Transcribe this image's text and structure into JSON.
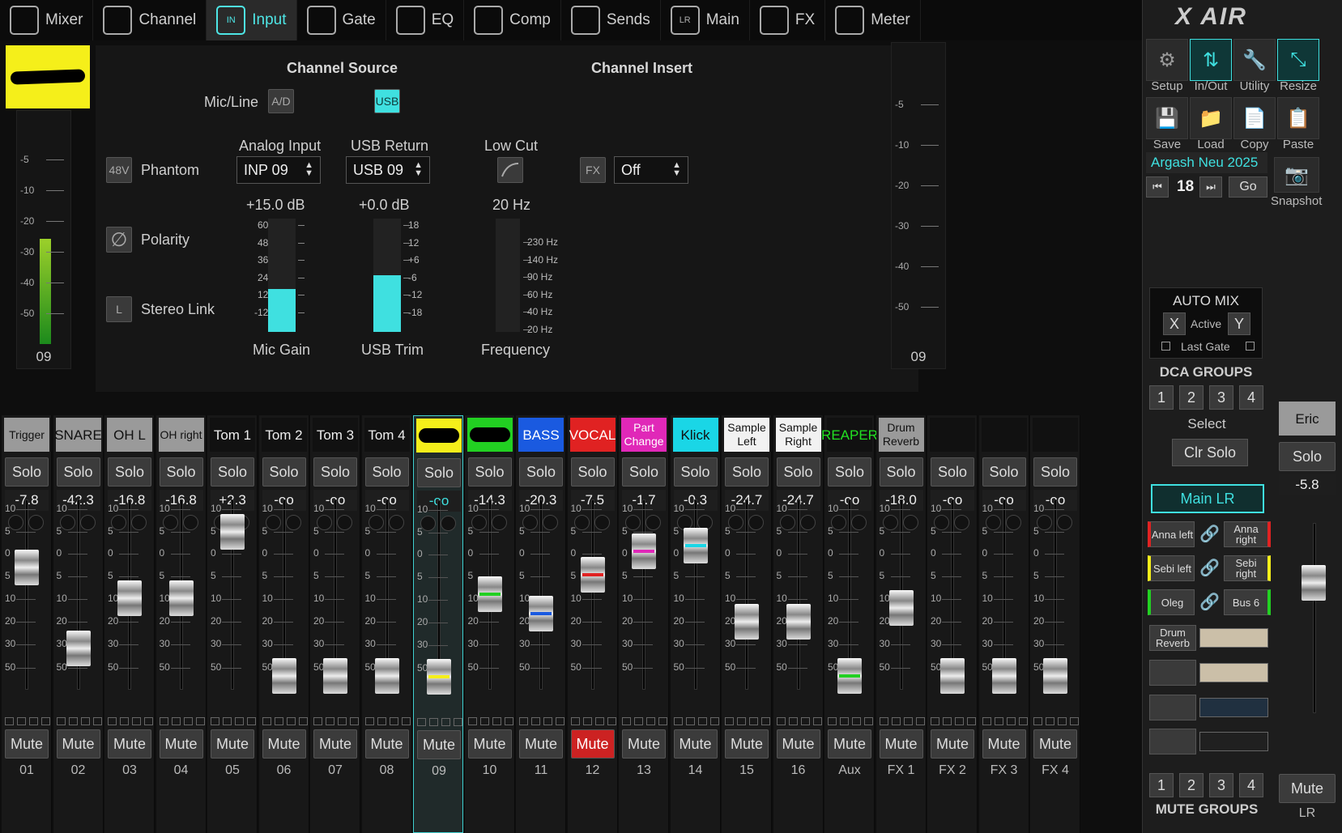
{
  "tabs": [
    {
      "label": "Mixer",
      "icon": "mixer-icon"
    },
    {
      "label": "Channel",
      "icon": "channel-icon"
    },
    {
      "label": "Input",
      "icon": "input-icon",
      "icon_text": "IN"
    },
    {
      "label": "Gate",
      "icon": "gate-icon"
    },
    {
      "label": "EQ",
      "icon": "eq-icon"
    },
    {
      "label": "Comp",
      "icon": "comp-icon"
    },
    {
      "label": "Sends",
      "icon": "sends-icon"
    },
    {
      "label": "Main",
      "icon": "main-icon",
      "icon_text": "LR"
    },
    {
      "label": "FX",
      "icon": "fx-icon"
    },
    {
      "label": "Meter",
      "icon": "meter-icon"
    }
  ],
  "active_tab": "Input",
  "left_meter": {
    "scale": [
      "-5",
      "-10",
      "-20",
      "-30",
      "-40",
      "-50"
    ],
    "channel": "09",
    "level_fraction": 0.48
  },
  "right_meter": {
    "scale": [
      "-5",
      "-10",
      "-20",
      "-30",
      "-40",
      "-50"
    ],
    "channel": "09"
  },
  "input_panel": {
    "channel_source_title": "Channel Source",
    "channel_insert_title": "Channel Insert",
    "mic_line_label": "Mic/Line",
    "ad_button": "A/D",
    "usb_button": "USB",
    "phantom_button": "48V",
    "phantom_label": "Phantom",
    "polarity_icon": "∅",
    "polarity_label": "Polarity",
    "stereo_link_button": "L",
    "stereo_link_label": "Stereo Link",
    "analog_input_label": "Analog Input",
    "analog_input_value": "INP 09",
    "usb_return_label": "USB Return",
    "usb_return_value": "USB 09",
    "low_cut_label": "Low Cut",
    "fx_button": "FX",
    "insert_value": "Off",
    "mic_gain_value": "+15.0 dB",
    "usb_trim_value": "+0.0 dB",
    "freq_value": "20 Hz",
    "mic_gain_label": "Mic Gain",
    "usb_trim_label": "USB Trim",
    "freq_label": "Frequency",
    "mic_gain_scale": [
      "60",
      "48",
      "36",
      "24",
      "12",
      "-12"
    ],
    "usb_trim_scale": [
      "18",
      "12",
      "+6",
      "-6",
      "-12",
      "-18"
    ],
    "freq_scale": [
      "230 Hz",
      "140 Hz",
      "90 Hz",
      "60 Hz",
      "40 Hz",
      "20 Hz"
    ],
    "mic_gain_fraction": 0.38,
    "usb_trim_fraction": 0.5
  },
  "strip_labels": {
    "solo": "Solo",
    "mute": "Mute",
    "fader_scale": [
      "10",
      "5",
      "0",
      "5",
      "10",
      "20",
      "30",
      "50"
    ]
  },
  "channels": [
    {
      "name": "Trigger",
      "gain": "-7.8",
      "num": "01",
      "bg": "#9a9a9a",
      "fg": "#111",
      "cap": 0.34,
      "mark": "",
      "muted": false
    },
    {
      "name": "SNARE",
      "gain": "-42.3",
      "num": "02",
      "bg": "#9a9a9a",
      "fg": "#111",
      "cap": 0.76,
      "mark": "",
      "muted": false
    },
    {
      "name": "OH L",
      "gain": "-16.8",
      "num": "03",
      "bg": "#9a9a9a",
      "fg": "#111",
      "cap": 0.5,
      "mark": "",
      "muted": false
    },
    {
      "name": "OH right",
      "gain": "-16.8",
      "num": "04",
      "bg": "#9a9a9a",
      "fg": "#111",
      "cap": 0.5,
      "mark": "",
      "muted": false
    },
    {
      "name": "Tom 1",
      "gain": "+2.3",
      "num": "05",
      "bg": "#111",
      "fg": "#eee",
      "cap": 0.16,
      "mark": "",
      "muted": false
    },
    {
      "name": "Tom 2",
      "gain": "-oo",
      "num": "06",
      "bg": "#111",
      "fg": "#eee",
      "cap": 0.9,
      "mark": "",
      "muted": false
    },
    {
      "name": "Tom 3",
      "gain": "-oo",
      "num": "07",
      "bg": "#111",
      "fg": "#eee",
      "cap": 0.9,
      "mark": "",
      "muted": false
    },
    {
      "name": "Tom 4",
      "gain": "-oo",
      "num": "08",
      "bg": "#111",
      "fg": "#eee",
      "cap": 0.9,
      "mark": "",
      "muted": false
    },
    {
      "name": "",
      "gain": "-oo",
      "num": "09",
      "bg": "#f5ef1a",
      "fg": "#111",
      "cap": 0.9,
      "mark": "#f5ef1a",
      "muted": false
    },
    {
      "name": "",
      "gain": "-14.3",
      "num": "10",
      "bg": "#22d022",
      "fg": "#111",
      "cap": 0.48,
      "mark": "#22d022",
      "muted": false
    },
    {
      "name": "BASS",
      "gain": "-20.3",
      "num": "11",
      "bg": "#1a5ae0",
      "fg": "#fff",
      "cap": 0.58,
      "mark": "#1a5ae0",
      "muted": false
    },
    {
      "name": "VOCAL",
      "gain": "-7.5",
      "num": "12",
      "bg": "#e02222",
      "fg": "#fff",
      "cap": 0.38,
      "mark": "#e02222",
      "muted": true
    },
    {
      "name": "Part Change",
      "gain": "-1.7",
      "num": "13",
      "bg": "#e028b8",
      "fg": "#fff",
      "cap": 0.26,
      "mark": "#e028b8",
      "muted": false
    },
    {
      "name": "Klick",
      "gain": "-0.3",
      "num": "14",
      "bg": "#1ad6e6",
      "fg": "#111",
      "cap": 0.23,
      "mark": "#1ad6e6",
      "muted": false
    },
    {
      "name": "Sample Left",
      "gain": "-24.7",
      "num": "15",
      "bg": "#f2f2f2",
      "fg": "#111",
      "cap": 0.62,
      "mark": "",
      "muted": false
    },
    {
      "name": "Sample Right",
      "gain": "-24.7",
      "num": "16",
      "bg": "#f2f2f2",
      "fg": "#111",
      "cap": 0.62,
      "mark": "",
      "muted": false
    },
    {
      "name": "REAPER",
      "gain": "-oo",
      "num": "Aux",
      "bg": "#111",
      "fg": "#22e022",
      "cap": 0.9,
      "mark": "#22d022",
      "muted": false
    },
    {
      "name": "Drum Reverb",
      "gain": "-18.0",
      "num": "FX 1",
      "bg": "#9a9a9a",
      "fg": "#111",
      "cap": 0.55,
      "mark": "",
      "muted": false
    },
    {
      "name": "",
      "gain": "-oo",
      "num": "FX 2",
      "bg": "#111",
      "fg": "#eee",
      "cap": 0.9,
      "mark": "",
      "muted": false
    },
    {
      "name": "",
      "gain": "-oo",
      "num": "FX 3",
      "bg": "#111",
      "fg": "#eee",
      "cap": 0.9,
      "mark": "",
      "muted": false
    },
    {
      "name": "",
      "gain": "-oo",
      "num": "FX 4",
      "bg": "#111",
      "fg": "#eee",
      "cap": 0.9,
      "mark": "",
      "muted": false
    }
  ],
  "right_panel": {
    "logo": "X AIR",
    "tools": [
      "Setup",
      "In/Out",
      "Utility",
      "Resize",
      "Save",
      "Load",
      "Copy",
      "Paste"
    ],
    "snapshot_name": "Argash Neu 2025",
    "snapshot_number": "18",
    "go": "Go",
    "snapshot_label": "Snapshot",
    "automix_title": "AUTO MIX",
    "automix_x": "X",
    "automix_active": "Active",
    "automix_y": "Y",
    "last_gate": "Last Gate",
    "dca_title": "DCA GROUPS",
    "dca": [
      "1",
      "2",
      "3",
      "4"
    ],
    "select_label": "Select",
    "clr_solo": "Clr Solo",
    "main_lr": "Main LR",
    "buses": [
      {
        "left": "Anna left",
        "right": "Anna right",
        "color": "#e02222"
      },
      {
        "left": "Sebi left",
        "right": "Sebi right",
        "color": "#f5ef1a"
      },
      {
        "left": "Oleg",
        "right": "Bus 6",
        "color": "#22d022"
      }
    ],
    "fx_slot": "Drum Reverb",
    "mute_groups_title": "MUTE GROUPS",
    "mute_groups": [
      "1",
      "2",
      "3",
      "4"
    ],
    "main_name": "Eric",
    "main_gain": "-5.8",
    "main_num": "LR",
    "main_cap": 0.3
  }
}
